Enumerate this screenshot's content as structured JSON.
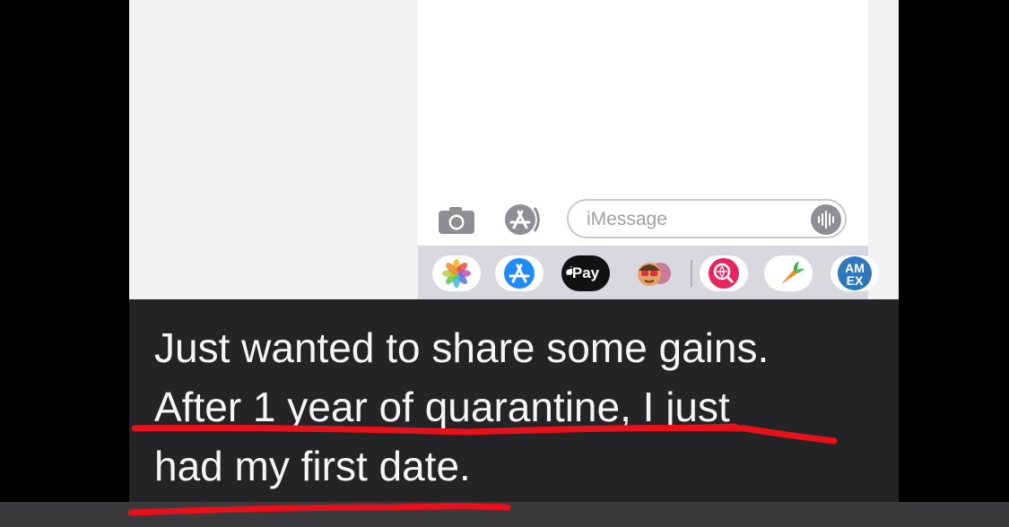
{
  "composer": {
    "message_placeholder": "iMessage",
    "camera_icon": "camera-icon",
    "app_store_icon": "app-store-icon",
    "audio_icon": "audio-waveform-icon"
  },
  "app_drawer": {
    "items": [
      {
        "name": "photos-app-icon"
      },
      {
        "name": "app-store-app-icon"
      },
      {
        "name": "apple-pay-app-icon",
        "label": "Pay"
      },
      {
        "name": "memoji-app-icon"
      },
      {
        "name": "web-search-app-icon"
      },
      {
        "name": "instacart-app-icon"
      },
      {
        "name": "amex-app-icon",
        "label": "AM EX"
      }
    ]
  },
  "caption": {
    "lines": [
      "Just wanted to share some gains.",
      "After 1 year of quarantine, I just",
      "had my first date."
    ]
  },
  "colors": {
    "caption_bg": "#242426",
    "caption_text": "#f5f5f7",
    "underline": "#e8101a",
    "app_store_blue": "#1f8cf5",
    "search_pink": "#e8265e",
    "amex_blue": "#2e77bc"
  }
}
